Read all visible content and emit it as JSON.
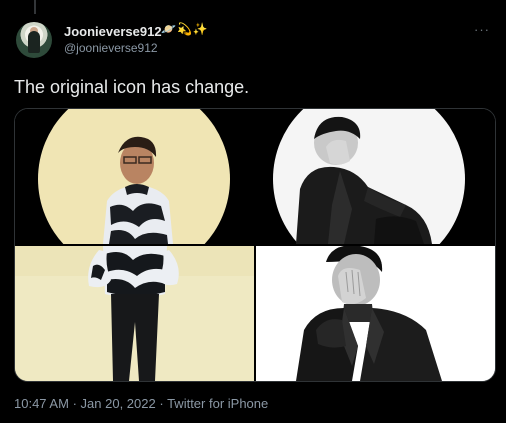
{
  "tweet": {
    "display_name": "Joonieverse912",
    "name_emojis": [
      "planet",
      "shooting-star",
      "sparkles"
    ],
    "handle": "@joonieverse912",
    "more_label": "···",
    "text": "The original icon has change.",
    "time": "10:47 AM",
    "date": "Jan 20, 2022",
    "separator": "·",
    "source": "Twitter for iPhone"
  },
  "media": {
    "photo_count": 4,
    "tiles": [
      {
        "name": "yellow circular portrait, patterned sweater"
      },
      {
        "name": "black and white circular portrait, leather jacket"
      },
      {
        "name": "full-length photo, patterned sweater on cream background"
      },
      {
        "name": "black and white photo, hand over face, leather jacket"
      }
    ]
  },
  "colors": {
    "background": "#000000",
    "text_primary": "#e7e9ea",
    "text_secondary": "#8b98a5",
    "border": "#2f3336"
  }
}
